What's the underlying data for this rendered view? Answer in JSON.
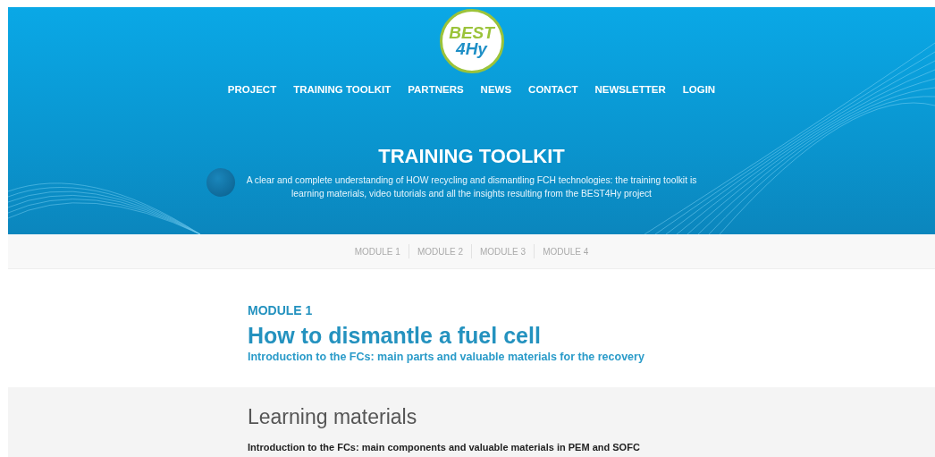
{
  "logo": {
    "line_1": "BEST",
    "line_2": "4Hy"
  },
  "nav": [
    {
      "label": "PROJECT"
    },
    {
      "label": "TRAINING TOOLKIT"
    },
    {
      "label": "PARTNERS"
    },
    {
      "label": "NEWS"
    },
    {
      "label": "CONTACT"
    },
    {
      "label": "NEWSLETTER"
    },
    {
      "label": "LOGIN"
    }
  ],
  "hero": {
    "title": "TRAINING TOOLKIT",
    "description": "A clear and complete understanding of HOW recycling and dismantling FCH technologies: the training toolkit is learning materials, video tutorials and all the insights resulting from the BEST4Hy project"
  },
  "module_tabs": [
    {
      "label": "MODULE 1"
    },
    {
      "label": "MODULE 2"
    },
    {
      "label": "MODULE 3"
    },
    {
      "label": "MODULE 4"
    }
  ],
  "module": {
    "kicker": "MODULE 1",
    "title": "How to dismantle a fuel cell",
    "subtitle": "Introduction to the FCs: main parts and valuable materials for the recovery"
  },
  "learning": {
    "heading": "Learning materials",
    "item": "Introduction to the FCs: main components and valuable materials in PEM and SOFC"
  }
}
